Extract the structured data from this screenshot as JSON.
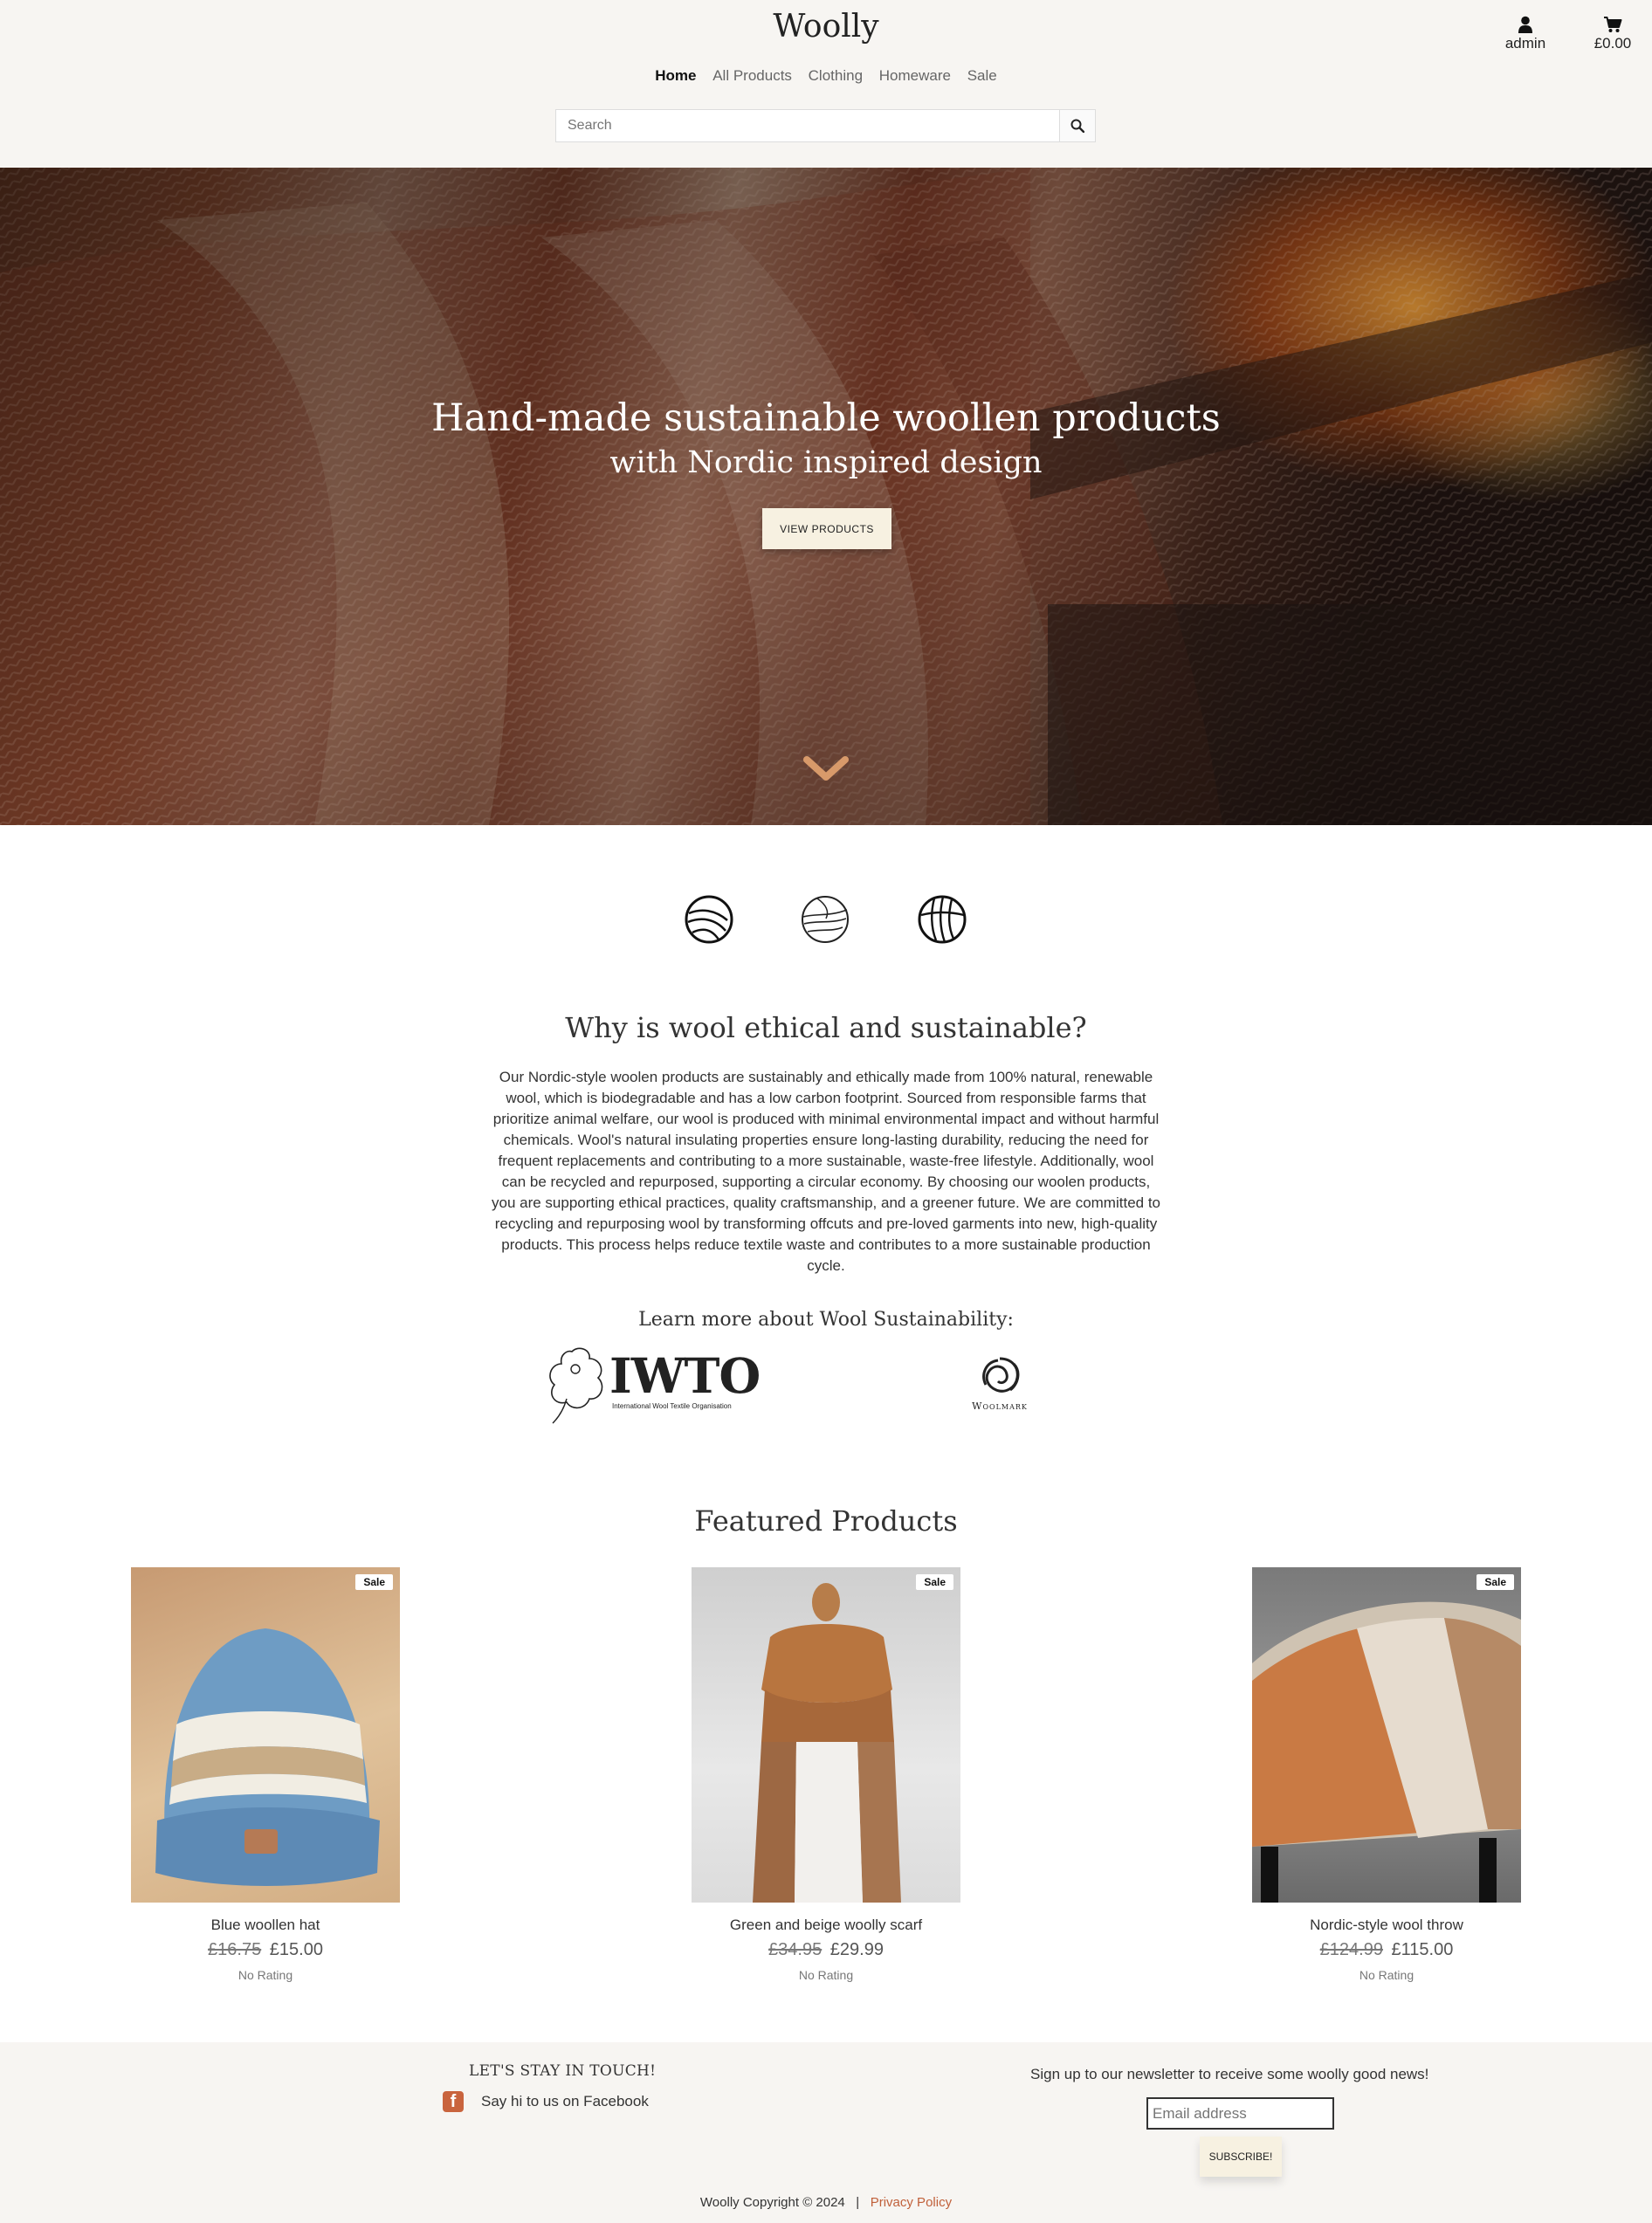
{
  "header": {
    "logo": "Woolly",
    "nav": [
      "Home",
      "All Products",
      "Clothing",
      "Homeware",
      "Sale"
    ],
    "search_placeholder": "Search",
    "account_label": "admin",
    "cart_total": "£0.00"
  },
  "hero": {
    "title": "Hand-made sustainable woollen products",
    "subtitle": "with Nordic inspired design",
    "button": "VIEW PRODUCTS"
  },
  "about": {
    "title": "Why is wool ethical and sustainable?",
    "text": "Our Nordic-style woolen products are sustainably and ethically made from 100% natural, renewable wool, which is biodegradable and has a low carbon footprint. Sourced from responsible farms that prioritize animal welfare, our wool is produced with minimal environmental impact and without harmful chemicals. Wool's natural insulating properties ensure long-lasting durability, reducing the need for frequent replacements and contributing to a more sustainable, waste-free lifestyle. Additionally, wool can be recycled and repurposed, supporting a circular economy. By choosing our woolen products, you are supporting ethical practices, quality craftsmanship, and a greener future. We are committed to recycling and repurposing wool by transforming offcuts and pre-loved garments into new, high-quality products. This process helps reduce textile waste and contributes to a more sustainable production cycle.",
    "learn_title": "Learn more about Wool Sustainability:",
    "iwto_logo": "IWTO",
    "iwto_caption": "International Wool Textile Organisation",
    "woolmark_logo": "Woolmark"
  },
  "featured": {
    "title": "Featured Products",
    "products": [
      {
        "name": "Blue woollen hat",
        "old_price": "£16.75",
        "price": "£15.00",
        "badge": "Sale",
        "rating": "No Rating"
      },
      {
        "name": "Green and beige woolly scarf",
        "old_price": "£34.95",
        "price": "£29.99",
        "badge": "Sale",
        "rating": "No Rating"
      },
      {
        "name": "Nordic-style wool throw",
        "old_price": "£124.99",
        "price": "£115.00",
        "badge": "Sale",
        "rating": "No Rating"
      }
    ]
  },
  "footer": {
    "stay_title": "LET'S STAY IN TOUCH!",
    "facebook_text": "Say hi to us on Facebook",
    "newsletter_text": "Sign up to our newsletter to receive some woolly good news!",
    "email_placeholder": "Email address",
    "subscribe_button": "SUBSCRIBE!",
    "copyright": "Woolly Copyright © 2024",
    "separator": "|",
    "privacy": "Privacy Policy"
  },
  "colors": {
    "accent": "#c9643e",
    "button_bg": "#f7f1e1",
    "header_bg": "#f7f5f2"
  }
}
